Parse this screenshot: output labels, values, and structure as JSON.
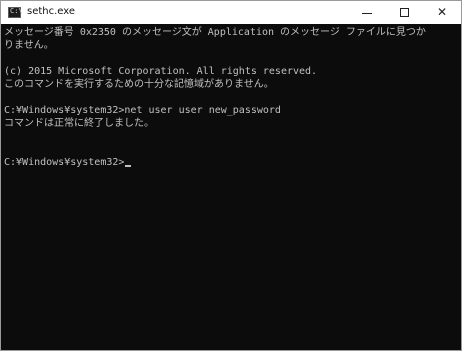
{
  "window": {
    "title": "sethc.exe",
    "icon": "console-app-icon",
    "buttons": {
      "minimize": "minimize-icon",
      "maximize": "maximize-icon",
      "close": "✕"
    }
  },
  "console": {
    "lines": [
      "メッセージ番号 0x2350 のメッセージ文が Application のメッセージ ファイルに見つか",
      "りません。",
      "",
      "(c) 2015 Microsoft Corporation. All rights reserved.",
      "このコマンドを実行するための十分な記憶域がありません。",
      "",
      "C:¥Windows¥system32>net user user new_password",
      "コマンドは正常に終了しました。",
      "",
      "",
      "C:¥Windows¥system32>"
    ]
  },
  "colors": {
    "console_background": "#0c0c0c",
    "console_text": "#c0c0c0",
    "titlebar_background": "#ffffff"
  }
}
